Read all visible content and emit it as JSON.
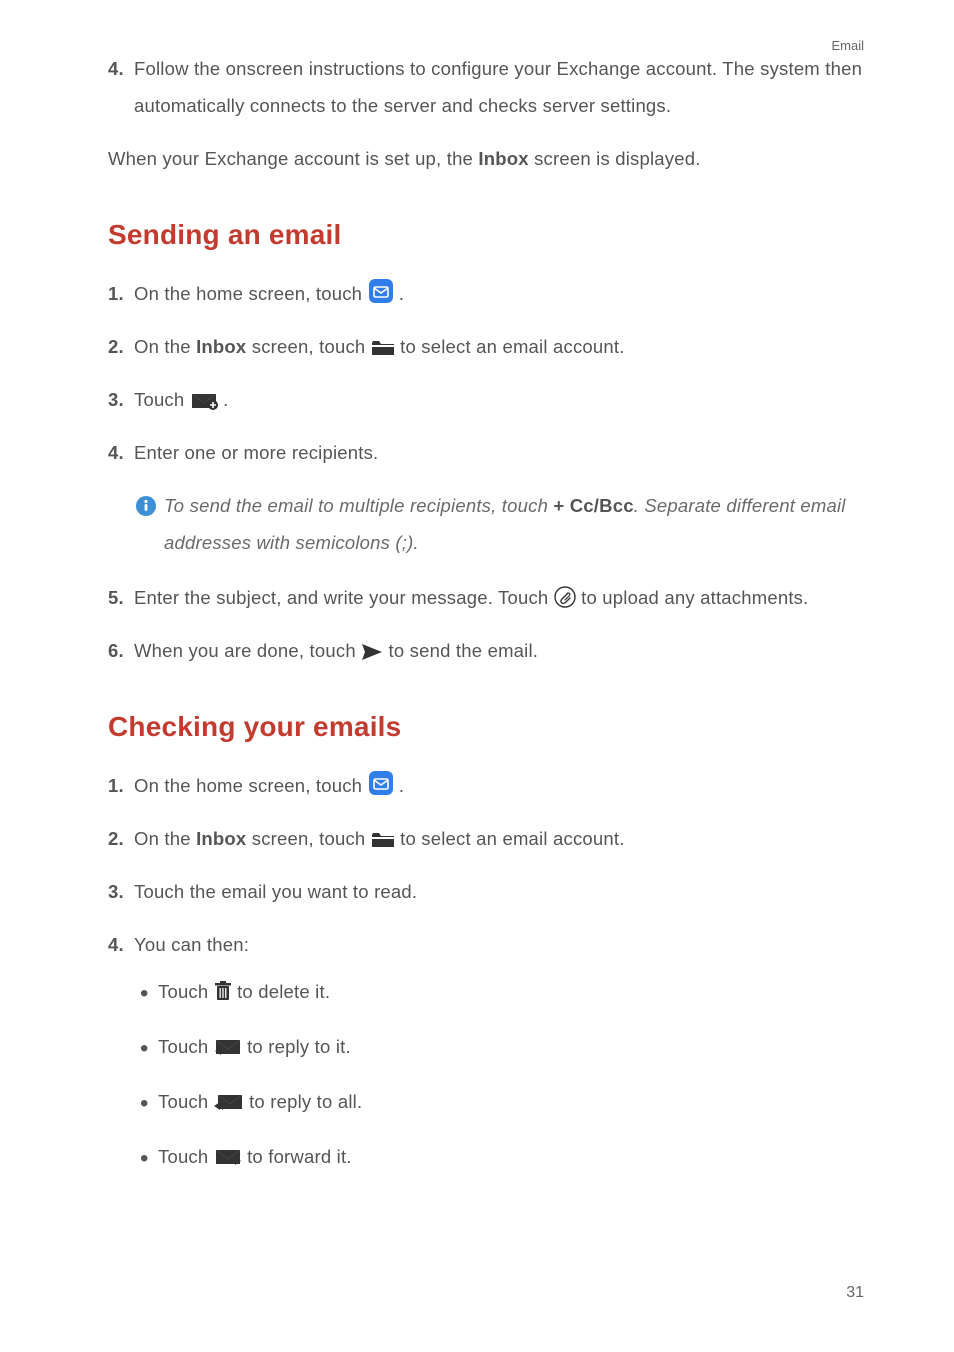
{
  "header_label": "Email",
  "page_number": "31",
  "intro_step": {
    "num": "4.",
    "text_a": "Follow the onscreen instructions to configure your Exchange account. The system then automatically connects to the server and checks server settings."
  },
  "intro_closer_a": "When your Exchange account is set up, the ",
  "intro_closer_b": "Inbox",
  "intro_closer_c": " screen is displayed.",
  "sending": {
    "heading": "Sending an email",
    "s1_num": "1.",
    "s1_a": "On the home screen, touch ",
    "s1_b": ".",
    "s2_num": "2.",
    "s2_a": "On the ",
    "s2_b": "Inbox",
    "s2_c": " screen, touch ",
    "s2_d": " to select an email account.",
    "s3_num": "3.",
    "s3_a": "Touch ",
    "s3_b": ".",
    "s4_num": "4.",
    "s4_a": "Enter one or more recipients.",
    "info_a": "To send the email to multiple recipients, touch ",
    "info_b": "+ Cc/Bcc",
    "info_c": ". Separate different email addresses with semicolons (;).",
    "s5_num": "5.",
    "s5_a": "Enter the subject, and write your message. Touch ",
    "s5_b": " to upload any attachments.",
    "s6_num": "6.",
    "s6_a": "When you are done, touch ",
    "s6_b": " to send the email."
  },
  "checking": {
    "heading": "Checking your emails",
    "s1_num": "1.",
    "s1_a": "On the home screen, touch ",
    "s1_b": ".",
    "s2_num": "2.",
    "s2_a": "On the ",
    "s2_b": "Inbox",
    "s2_c": " screen, touch ",
    "s2_d": " to select an email account.",
    "s3_num": "3.",
    "s3_a": "Touch the email you want to read.",
    "s4_num": "4.",
    "s4_a": "You can then:",
    "b1_a": "Touch ",
    "b1_b": " to delete it.",
    "b2_a": "Touch ",
    "b2_b": " to reply to it.",
    "b3_a": "Touch ",
    "b3_b": " to reply to all.",
    "b4_a": "Touch ",
    "b4_b": " to forward it."
  }
}
